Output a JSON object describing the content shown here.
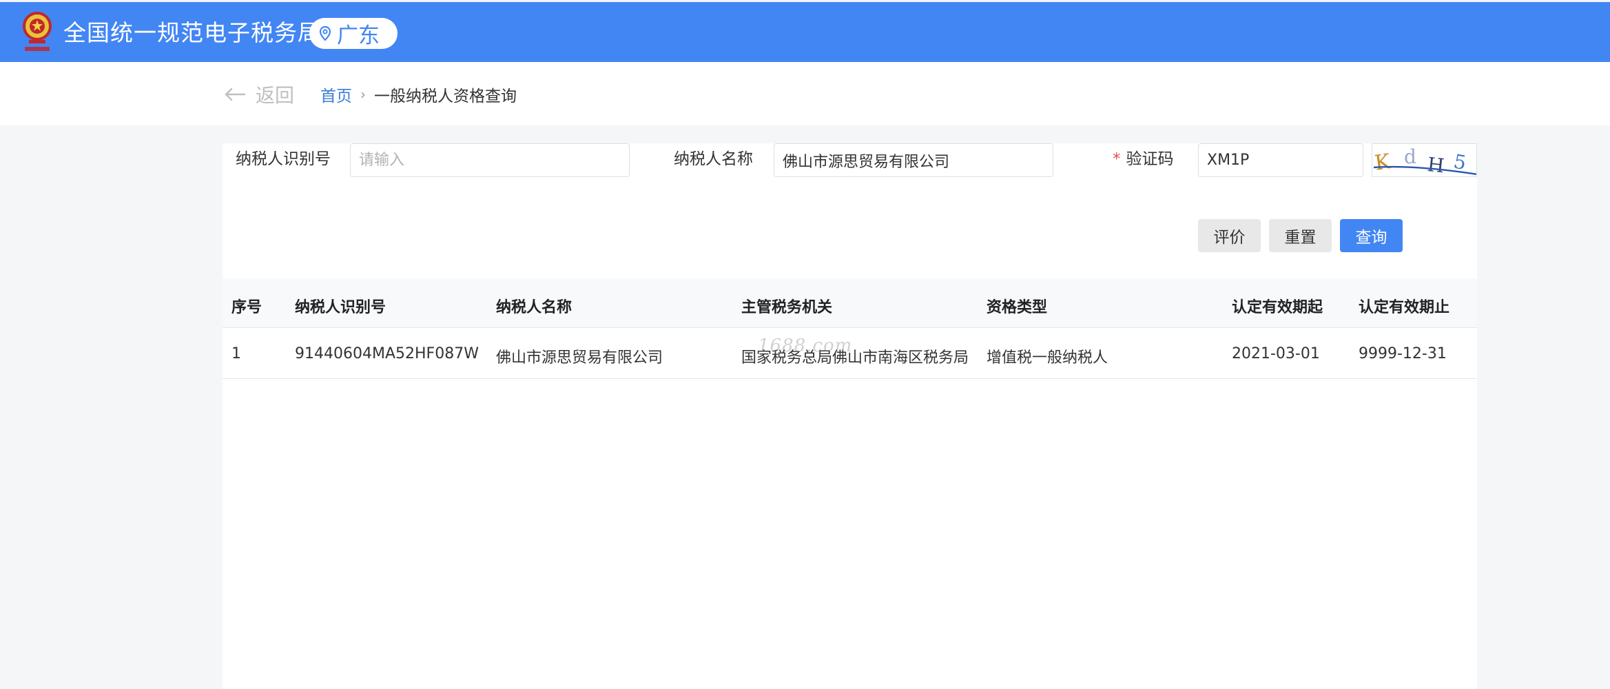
{
  "header": {
    "site_title": "全国统一规范电子税务局",
    "region": "广东",
    "brand_color": "#4286f4"
  },
  "breadcrumb": {
    "back_label": "返回",
    "home": "首页",
    "current": "一般纳税人资格查询"
  },
  "form": {
    "taxpayer_id_label": "纳税人识别号",
    "taxpayer_id_placeholder": "请输入",
    "taxpayer_id_value": "",
    "taxpayer_name_label": "纳税人名称",
    "taxpayer_name_value": "佛山市源思贸易有限公司",
    "captcha_required_mark": "*",
    "captcha_label": "验证码",
    "captcha_value": "XM1P",
    "captcha_image_text": "KdH5"
  },
  "buttons": {
    "evaluate": "评价",
    "reset": "重置",
    "query": "查询"
  },
  "table": {
    "columns": [
      "序号",
      "纳税人识别号",
      "纳税人名称",
      "主管税务机关",
      "资格类型",
      "认定有效期起",
      "认定有效期止"
    ],
    "rows": [
      [
        "1",
        "91440604MA52HF087W",
        "佛山市源思贸易有限公司",
        "国家税务总局佛山市南海区税务局",
        "增值税一般纳税人",
        "2021-03-01",
        "9999-12-31"
      ]
    ]
  },
  "watermark": "1688.com"
}
